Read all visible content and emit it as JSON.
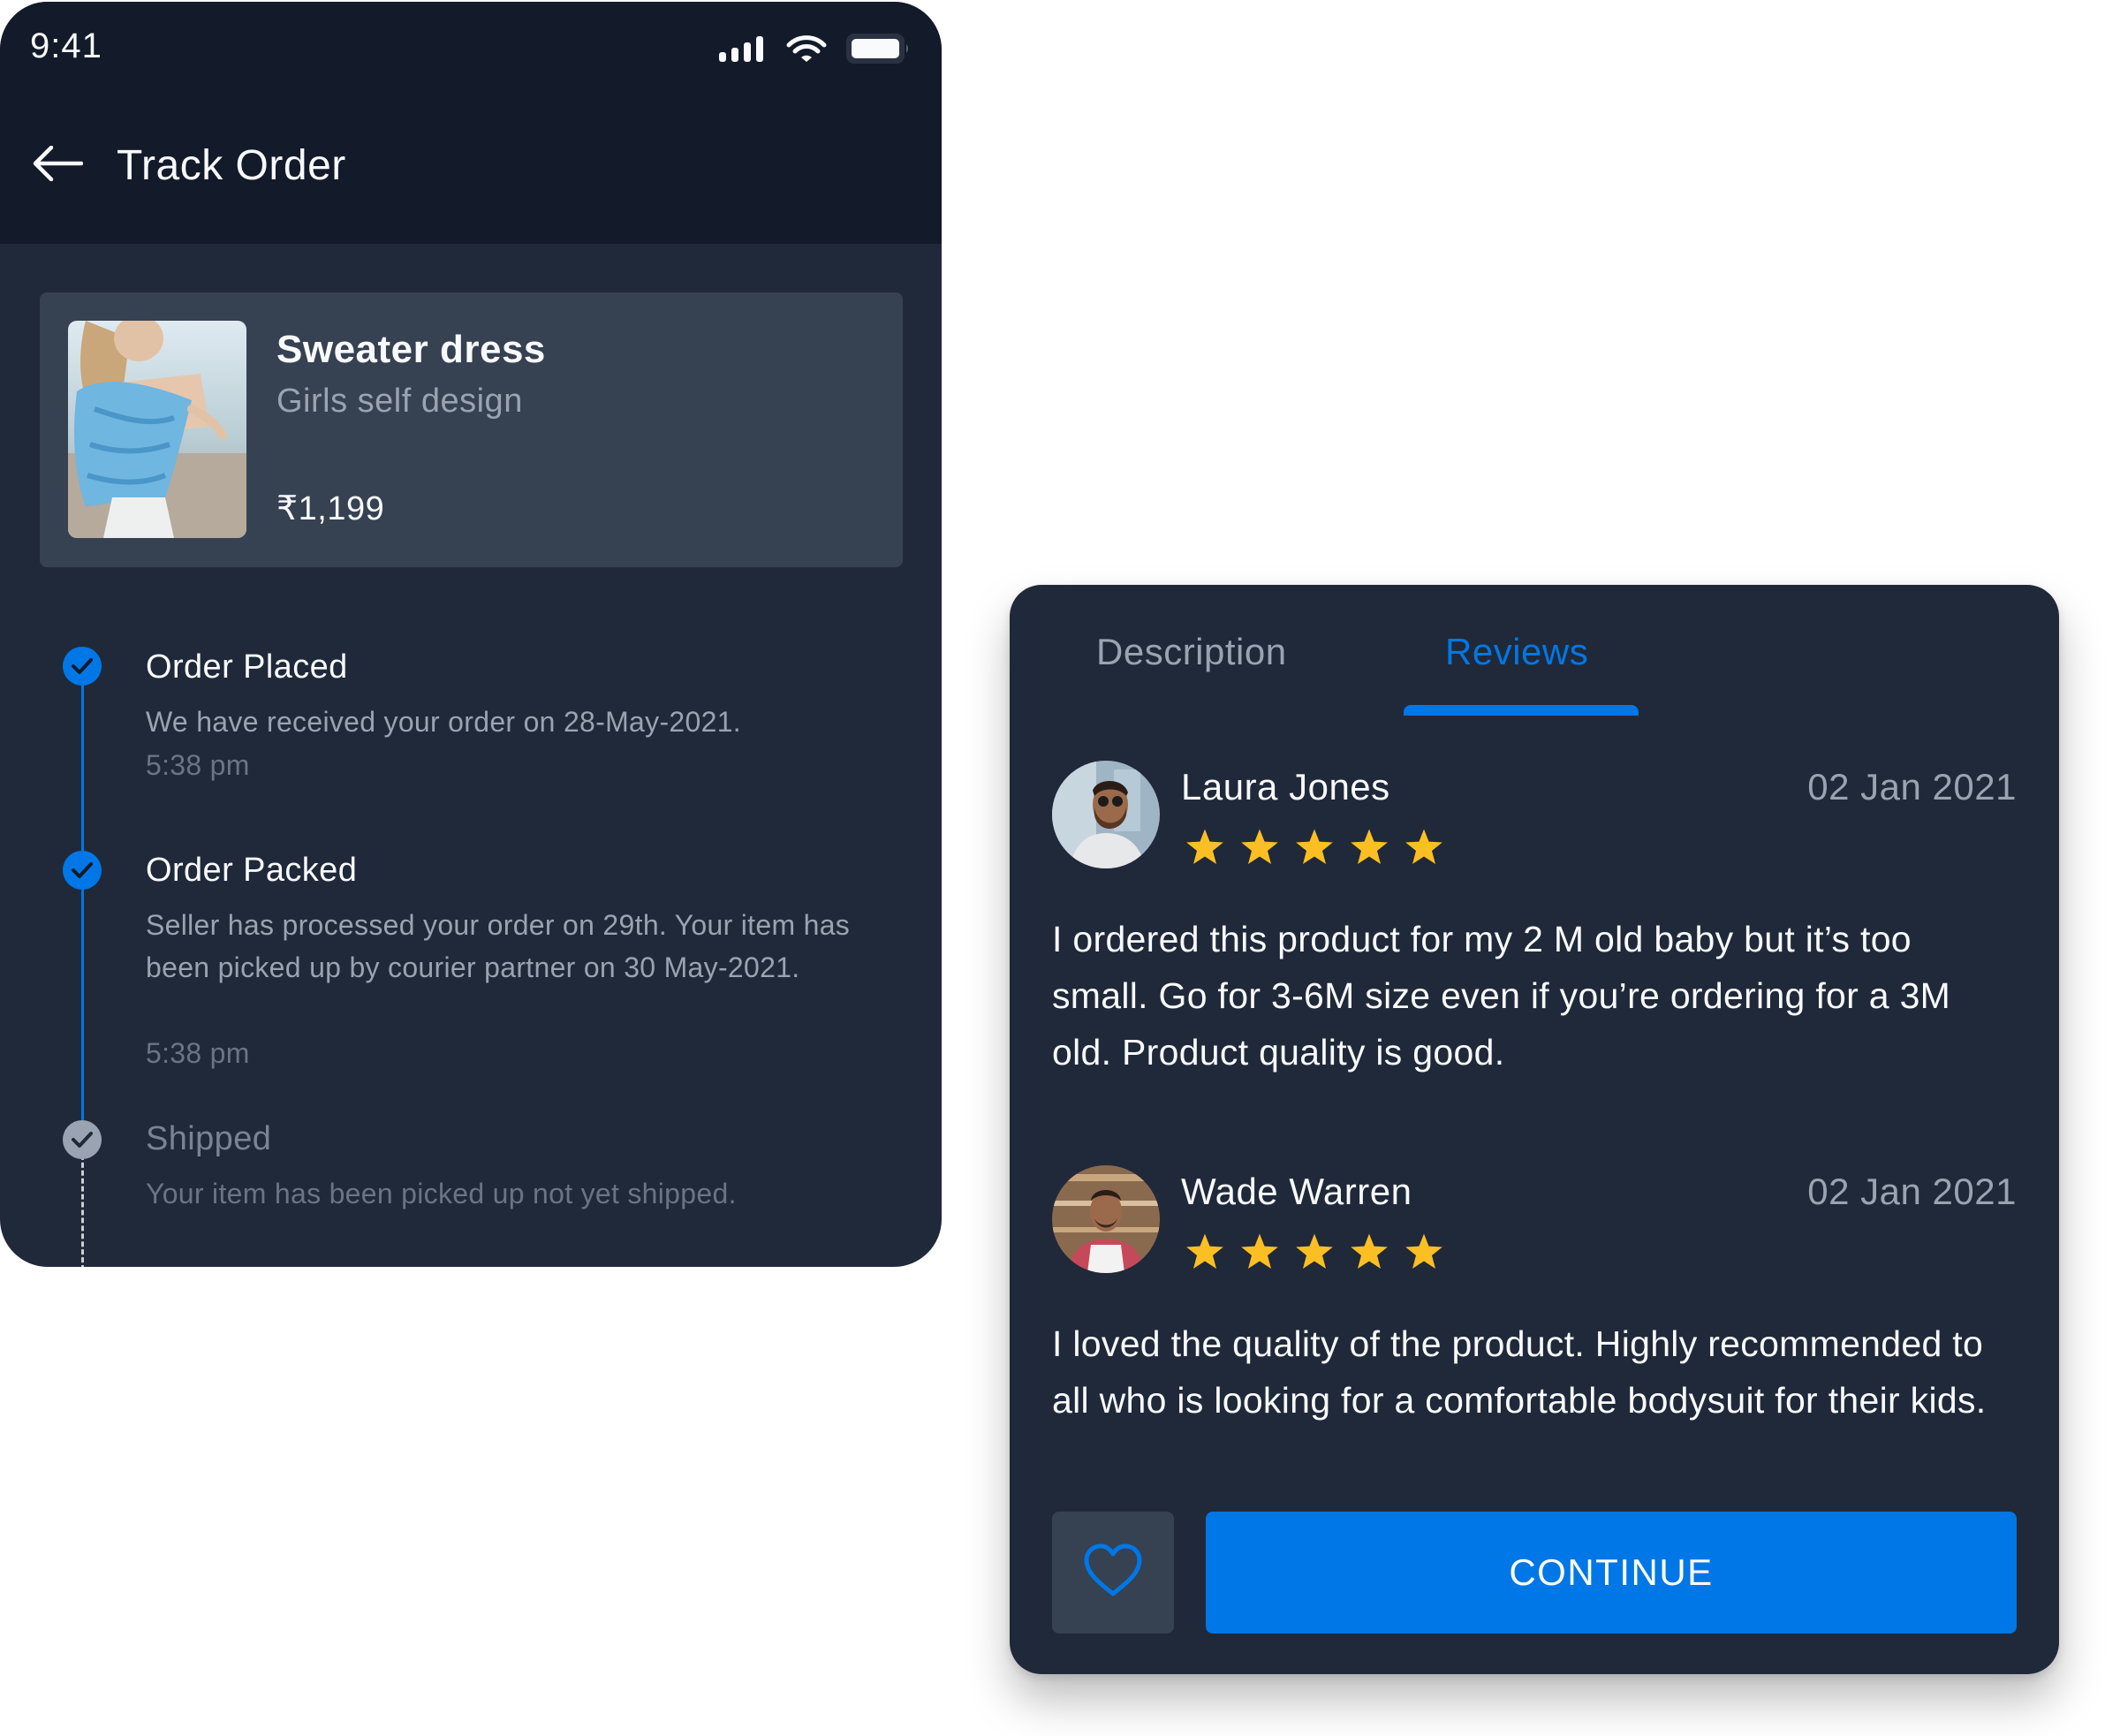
{
  "track_order": {
    "status_bar": {
      "time": "9:41",
      "icons": [
        "signal-icon",
        "wifi-icon",
        "battery-icon"
      ]
    },
    "header": {
      "title": "Track Order",
      "back_icon": "arrow-left-icon"
    },
    "product": {
      "name": "Sweater dress",
      "subtitle": "Girls self design",
      "price": "₹1,199",
      "image": "product-photo"
    },
    "timeline": [
      {
        "title": "Order Placed",
        "description": "We have received your order on 28-May-2021.",
        "time": "5:38 pm",
        "status": "done"
      },
      {
        "title": "Order Packed",
        "description": "Seller has processed your order on 29th. Your item has been picked up by courier partner on 30 May-2021.",
        "time": "5:38 pm",
        "status": "done"
      },
      {
        "title": "Shipped",
        "description": "Your item has been picked up not yet shipped.",
        "time": "",
        "status": "pending"
      }
    ]
  },
  "product_details": {
    "tabs": [
      {
        "label": "Description",
        "active": false
      },
      {
        "label": "Reviews",
        "active": true
      }
    ],
    "reviews": [
      {
        "name": "Laura Jones",
        "date": "02 Jan 2021",
        "rating": 5,
        "max_rating": 5,
        "text": "I ordered this product for my 2 M old baby but it’s too small. Go for 3-6M size even if you’re ordering for a 3M old. Product quality is good."
      },
      {
        "name": "Wade Warren",
        "date": "02 Jan 2021",
        "rating": 5,
        "max_rating": 5,
        "text": "I loved the quality of the product. Highly recommended to all who is looking for a comfortable bodysuit for their kids."
      }
    ],
    "favorite_icon": "heart-outline-icon",
    "continue_label": "CONTINUE"
  },
  "colors": {
    "accent": "#0077e6",
    "header_bg": "#131a29",
    "surface": "#202939",
    "card": "#364152",
    "star": "#fbbf24",
    "muted_text": "#9aa3b2"
  }
}
